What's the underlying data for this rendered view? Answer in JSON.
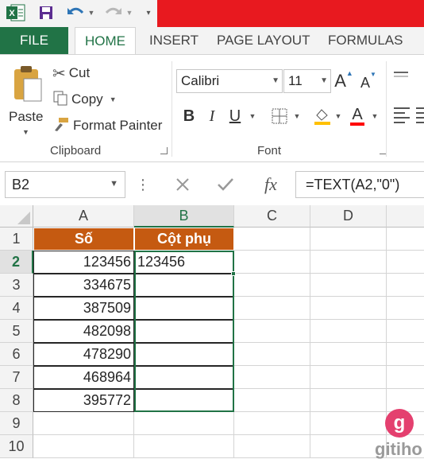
{
  "app": {
    "name": "Excel",
    "accent_color": "#217346",
    "header_color": "#c55a11",
    "redaction_color": "#e8191f"
  },
  "quick_access": {
    "icons": [
      "excel-icon",
      "save-icon",
      "undo-icon",
      "redo-icon",
      "customize-icon"
    ]
  },
  "tabs": [
    {
      "label": "FILE"
    },
    {
      "label": "HOME",
      "active": true
    },
    {
      "label": "INSERT"
    },
    {
      "label": "PAGE LAYOUT"
    },
    {
      "label": "FORMULAS"
    }
  ],
  "ribbon": {
    "clipboard": {
      "label": "Clipboard",
      "paste": "Paste",
      "cut": "Cut",
      "copy": "Copy",
      "format_painter": "Format Painter"
    },
    "font": {
      "label": "Font",
      "font_name": "Calibri",
      "font_size": "11",
      "bold": "B",
      "italic": "I",
      "underline": "U",
      "font_color_letter": "A",
      "grow_letter": "A",
      "shrink_letter": "A"
    }
  },
  "formula_bar": {
    "name_box": "B2",
    "fx": "fx",
    "formula": "=TEXT(A2,\"0\")"
  },
  "sheet": {
    "columns": [
      "A",
      "B",
      "C",
      "D",
      "E"
    ],
    "selected_column": "B",
    "rows": [
      "1",
      "2",
      "3",
      "4",
      "5",
      "6",
      "7",
      "8",
      "9",
      "10"
    ],
    "selected_row": "2",
    "header": {
      "a": "Số",
      "b": "Cột phụ"
    },
    "data": [
      {
        "a": "123456",
        "b": "123456"
      },
      {
        "a": "334675",
        "b": ""
      },
      {
        "a": "387509",
        "b": ""
      },
      {
        "a": "482098",
        "b": ""
      },
      {
        "a": "478290",
        "b": ""
      },
      {
        "a": "468964",
        "b": ""
      },
      {
        "a": "395772",
        "b": ""
      }
    ]
  },
  "watermark": {
    "logo_letter": "g",
    "text": "gitiho"
  }
}
